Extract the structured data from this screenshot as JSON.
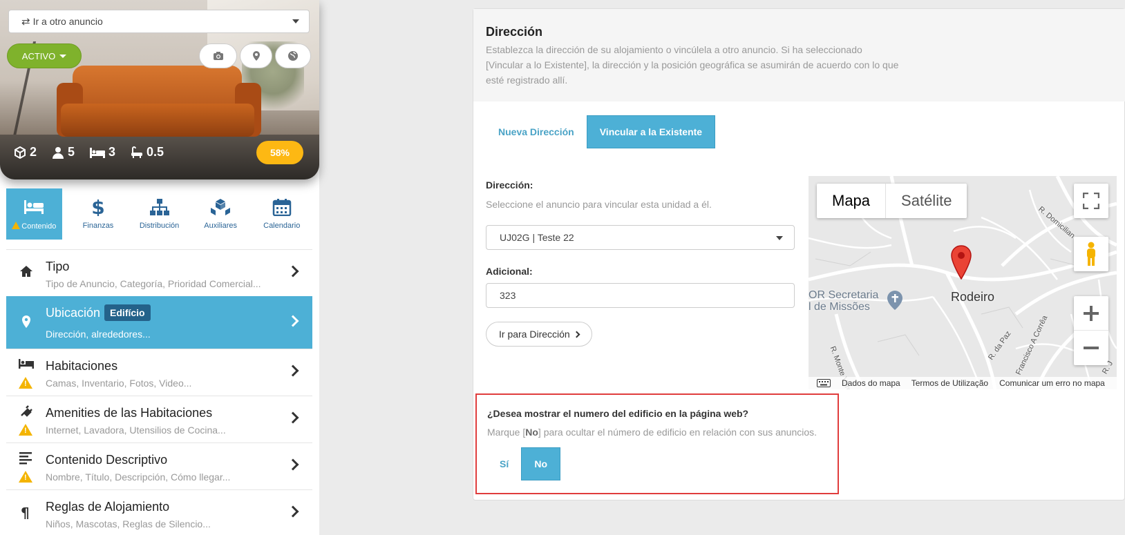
{
  "sidebar": {
    "goto_label": "Ir a otro anuncio",
    "status_label": "ACTIVO",
    "stats": {
      "units": "2",
      "guests": "5",
      "beds": "3",
      "baths": "0.5"
    },
    "completion": "58%",
    "tabs": [
      {
        "label": "Contenido"
      },
      {
        "label": "Finanzas"
      },
      {
        "label": "Distribución"
      },
      {
        "label": "Auxiliares"
      },
      {
        "label": "Calendario"
      }
    ],
    "menu": [
      {
        "title": "Tipo",
        "subtitle": "Tipo de Anuncio, Categoría, Prioridad Comercial..."
      },
      {
        "title": "Ubicación",
        "badge": "Edifício",
        "subtitle": "Dirección, alrededores..."
      },
      {
        "title": "Habitaciones",
        "subtitle": "Camas, Inventario, Fotos, Video..."
      },
      {
        "title": "Amenities de las Habitaciones",
        "subtitle": "Internet, Lavadora, Utensilios de Cocina..."
      },
      {
        "title": "Contenido Descriptivo",
        "subtitle": "Nombre, Título, Descripción, Cómo llegar..."
      },
      {
        "title": "Reglas de Alojamiento",
        "subtitle": "Niños, Mascotas, Reglas de Silencio..."
      }
    ]
  },
  "main": {
    "title": "Dirección",
    "description": "Establezca la dirección de su alojamiento o vincúlela a otro anuncio. Si ha seleccionado [Vincular a lo Existente], la dirección y la posición geográfica se asumirán de acuerdo con lo que esté registrado allí.",
    "toggle": {
      "new": "Nueva Dirección",
      "link": "Vincular a la Existente"
    },
    "address_label": "Dirección:",
    "address_hint": "Seleccione el anuncio para vincular esta unidad a él.",
    "address_value": "UJ02G | Teste 22",
    "additional_label": "Adicional:",
    "additional_value": "323",
    "go_button": "Ir para Dirección",
    "map": {
      "type_map": "Mapa",
      "type_satellite": "Satélite",
      "place_label": "Rodeiro",
      "poi_line1": "OR Secretaria",
      "poi_line2": "l de Missões",
      "street1": "R. Monte Verde",
      "street2": "R. da Paz",
      "street3": "Francisco A Corrêa",
      "street4": "R. Domicilian",
      "street5": "R. J",
      "footer_data": "Dados do mapa",
      "footer_terms": "Termos de Utilização",
      "footer_report": "Comunicar um erro no mapa"
    },
    "question": {
      "title": "¿Desea mostrar el numero del edificio en la página web?",
      "hint_pre": "Marque [",
      "hint_bold": "No",
      "hint_post": "] para ocultar el número de edificio en relación con sus anuncios.",
      "yes": "Sí",
      "no": "No"
    }
  }
}
